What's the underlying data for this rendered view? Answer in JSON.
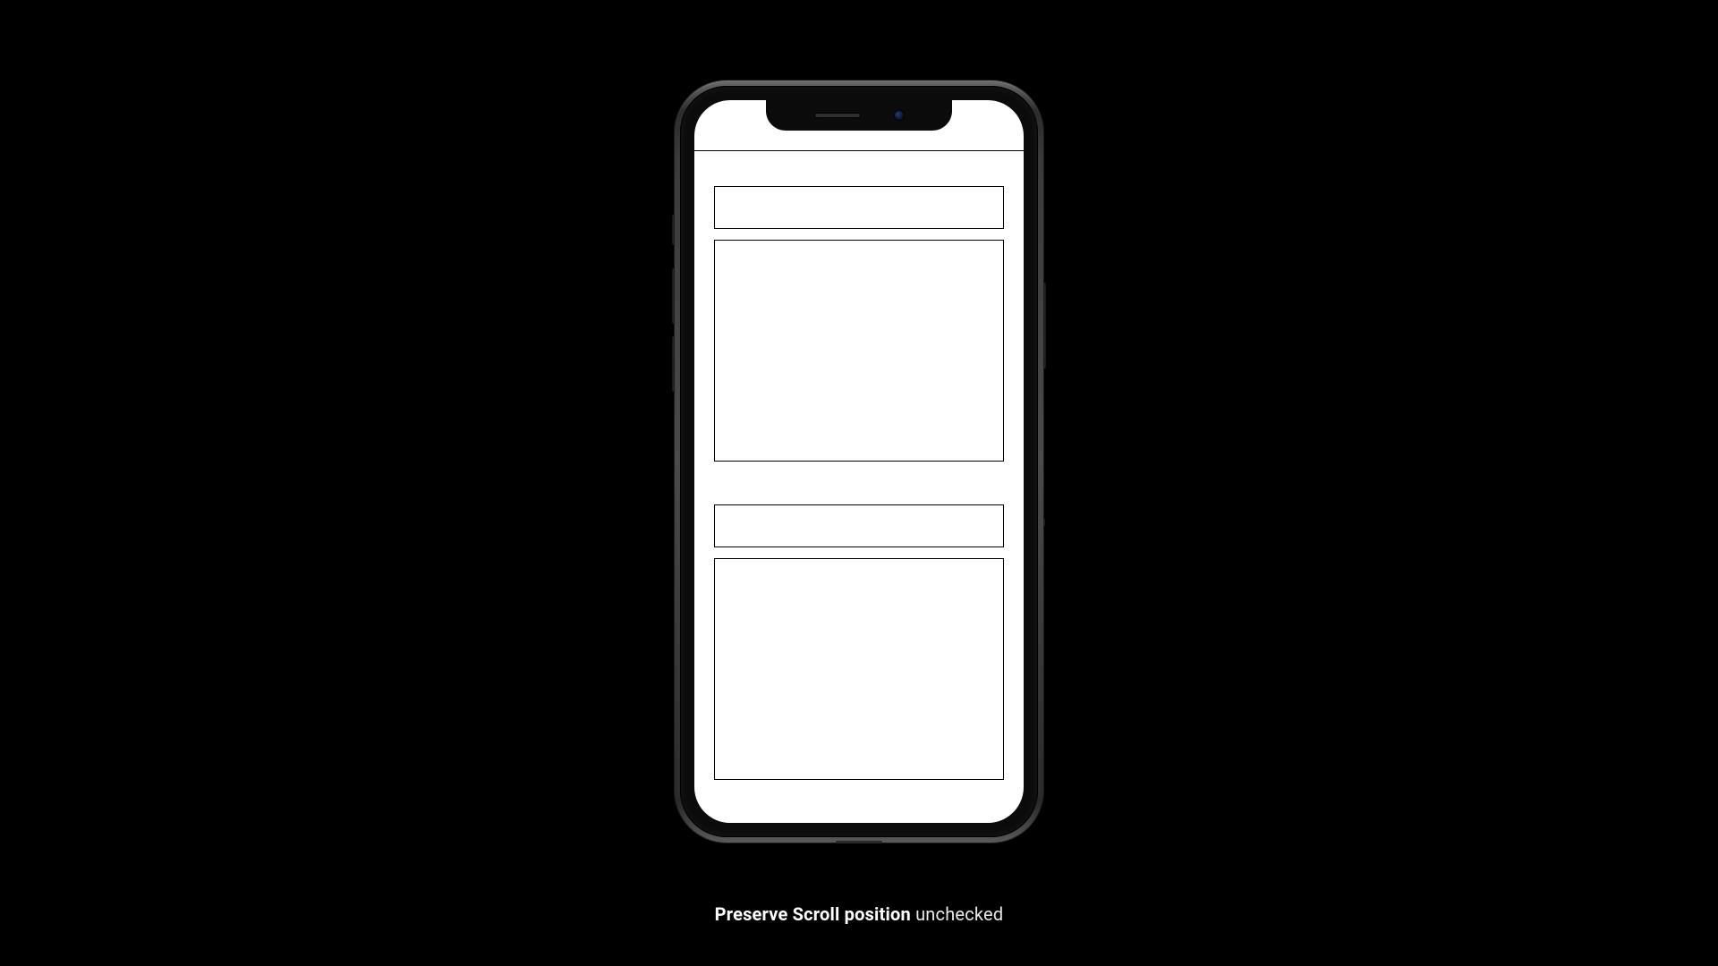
{
  "caption": {
    "bold": "Preserve Scroll position",
    "rest": " unchecked"
  },
  "device": {
    "type": "iPhone-mockup",
    "notch": {
      "speaker": true,
      "camera": true
    }
  },
  "wireframe": {
    "groups": [
      {
        "header_box": "",
        "body_box": ""
      },
      {
        "header_box": "",
        "body_box": ""
      }
    ]
  }
}
